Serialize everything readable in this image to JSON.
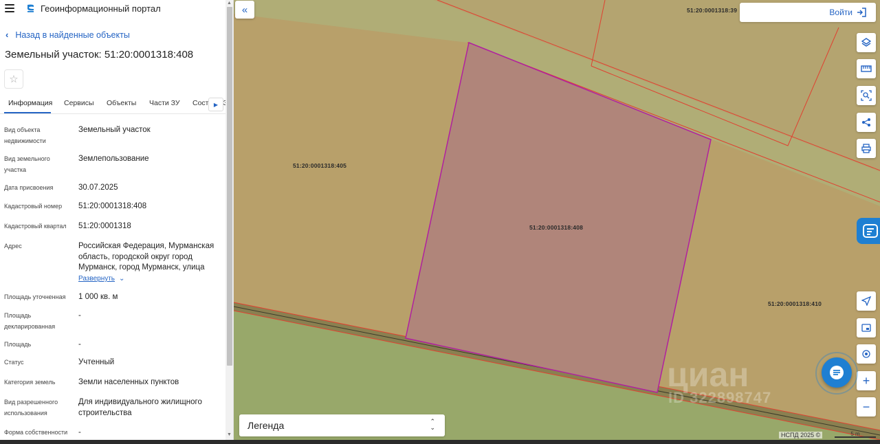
{
  "header": {
    "portal_title": "Геоинформационный портал"
  },
  "panel": {
    "back_link": "Назад в найденные объекты",
    "object_title": "Земельный участок: 51:20:0001318:408",
    "tabs": [
      {
        "label": "Информация",
        "active": true
      },
      {
        "label": "Сервисы"
      },
      {
        "label": "Объекты"
      },
      {
        "label": "Части ЗУ"
      },
      {
        "label": "Состав ЕЗ"
      }
    ],
    "properties": [
      {
        "label": "Вид объекта недвижимости",
        "value": "Земельный участок"
      },
      {
        "label": "Вид земельного участка",
        "value": "Землепользование"
      },
      {
        "label": "Дата присвоения",
        "value": "30.07.2025"
      },
      {
        "label": "Кадастровый номер",
        "value": "51:20:0001318:408"
      },
      {
        "label": "Кадастровый квартал",
        "value": "51:20:0001318"
      },
      {
        "label": "Адрес",
        "value": "Российская Федерация, Мурманская область, городской округ город Мурманск, город Мурманск, улица"
      },
      {
        "label": "Площадь уточненная",
        "value": "1 000 кв. м"
      },
      {
        "label": "Площадь декларированная",
        "value": "-"
      },
      {
        "label": "Площадь",
        "value": "-"
      },
      {
        "label": "Статус",
        "value": "Учтенный"
      },
      {
        "label": "Категория земель",
        "value": "Земли населенных пунктов"
      },
      {
        "label": "Вид разрешенного использования",
        "value": "Для индивидуального жилищного строительства"
      },
      {
        "label": "Форма собственности",
        "value": "-"
      }
    ],
    "expand_label": "Развернуть"
  },
  "map": {
    "login_label": "Войти",
    "legend_label": "Легенда",
    "parcel_labels": {
      "selected": "51:20:0001318:408",
      "west": "51:20:0001318:405",
      "east": "51:20:0001318:410",
      "north": "51:20:0001318:39"
    },
    "watermark_brand": "циан",
    "watermark_id": "ID 322898747",
    "attribution": "НСПД 2025 ©",
    "scale_label": "5 m",
    "colors": {
      "parcel_fill": "#b8a06a",
      "road_fill": "#b0ad76",
      "green_fill": "#98a86a",
      "selected_fill": "#b0857a",
      "selected_stroke": "#b020a0",
      "boundary": "#e04030",
      "accent": "#1e7fd2"
    },
    "tools": [
      "layers-icon",
      "ruler-icon",
      "search-area-icon",
      "share-icon",
      "print-icon",
      "locate-icon",
      "minimap-icon",
      "geolocation-icon",
      "zoom-in-icon",
      "zoom-out-icon"
    ]
  }
}
